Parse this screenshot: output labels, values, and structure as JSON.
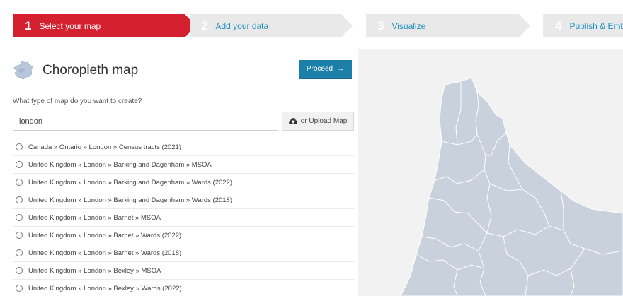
{
  "steps": [
    {
      "num": "1",
      "label": "Select your map"
    },
    {
      "num": "2",
      "label": "Add your data"
    },
    {
      "num": "3",
      "label": "Visualize"
    },
    {
      "num": "4",
      "label": "Publish & Embe"
    }
  ],
  "colors": {
    "active_step": "#d5202f",
    "inactive_step": "#e9e9e9",
    "step_link": "#1d8fbf",
    "primary_button": "#1c7fa8",
    "map_fill": "#c9d1dd"
  },
  "header": {
    "title": "Choropleth map",
    "proceed_label": "Proceed",
    "proceed_icon": "arrow-right-icon",
    "map_icon": "france-map-icon"
  },
  "question": "What type of map do you want to create?",
  "search": {
    "value": "london"
  },
  "upload": {
    "label": "or Upload Map",
    "icon": "cloud-upload-icon"
  },
  "options": [
    "Canada » Ontario » London » Census tracts (2021)",
    "United Kingdom » London » Barking and Dagenham » MSOA",
    "United Kingdom » London » Barking and Dagenham » Wards (2022)",
    "United Kingdom » London » Barking and Dagenham » Wards (2018)",
    "United Kingdom » London » Barnet » MSOA",
    "United Kingdom » London » Barnet » Wards (2022)",
    "United Kingdom » London » Barnet » Wards (2018)",
    "United Kingdom » London » Bexley » MSOA",
    "United Kingdom » London » Bexley » Wards (2022)"
  ]
}
